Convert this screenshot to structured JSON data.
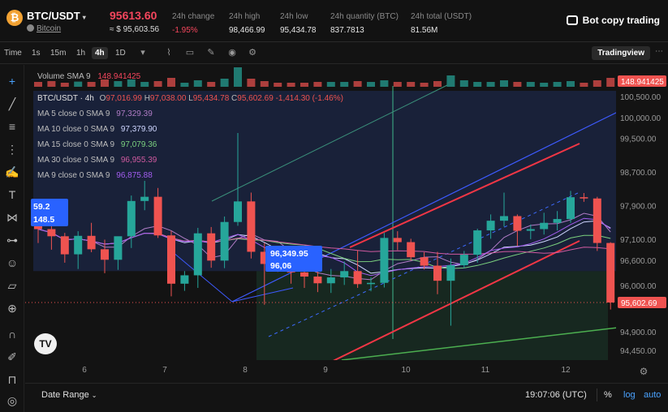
{
  "header": {
    "coin_symbol": "₿",
    "pair": "BTC/USDT",
    "pair_caret": "▾",
    "coin_name": "Bitcoin",
    "price": "95613.60",
    "price_usd": "≈ $ 95,603.56",
    "stats": [
      {
        "label": "24h change",
        "value": "-1.95%",
        "negative": true
      },
      {
        "label": "24h high",
        "value": "98,466.99"
      },
      {
        "label": "24h low",
        "value": "95,434.78"
      },
      {
        "label": "24h quantity (BTC)",
        "value": "837.7813"
      },
      {
        "label": "24h total (USDT)",
        "value": "81.56M"
      }
    ],
    "bot_copy": "Bot copy trading"
  },
  "toolbar": {
    "time_label": "Time",
    "intervals": [
      "1s",
      "15m",
      "1h",
      "4h",
      "1D"
    ],
    "active_interval": "4h",
    "tradingview": "Tradingview"
  },
  "legend": {
    "volume": "Volume SMA 9",
    "volume_value": "148.941425",
    "title": "BTC/USDT · 4h",
    "ohlc": {
      "o": "97,016.99",
      "h": "97,038.00",
      "l": "95,434.78",
      "c": "95,602.69",
      "chg": "-1,414.30 (-1.46%)"
    },
    "ma": [
      {
        "name": "MA 5 close 0 SMA 9",
        "value": "97,329.39",
        "color": "#b07cc6"
      },
      {
        "name": "MA 10 close 0 SMA 9",
        "value": "97,379.90",
        "color": "#cfd6ff"
      },
      {
        "name": "MA 15 close 0 SMA 9",
        "value": "97,079.36",
        "color": "#7bd17f"
      },
      {
        "name": "MA 30 close 0 SMA 9",
        "value": "96,955.39",
        "color": "#d05aa0"
      },
      {
        "name": "MA 9 close 0 SMA 9",
        "value": "96,875.88",
        "color": "#a35df0"
      }
    ]
  },
  "chart_data": {
    "type": "candlestick",
    "timeframe": "4h",
    "ylim": [
      94230,
      100760
    ],
    "y_ticks": [
      "100,500.00",
      "100,000.00",
      "99,500.00",
      "98,700.00",
      "97,900.00",
      "97,100.00",
      "96,600.00",
      "96,000.00",
      "94,900.00",
      "94,450.00"
    ],
    "x_ticks": [
      "6",
      "7",
      "8",
      "9",
      "10",
      "11",
      "12"
    ],
    "price_label": "95,602.69",
    "volume_label": "148.941425",
    "annotation_labels": [
      "96,349.95",
      "96,06",
      "59.2",
      "148.5"
    ],
    "candles": [
      {
        "o": 97640,
        "h": 97850,
        "l": 97020,
        "c": 97350
      },
      {
        "o": 97350,
        "h": 97560,
        "l": 96860,
        "c": 97180
      },
      {
        "o": 97180,
        "h": 97260,
        "l": 96550,
        "c": 96750
      },
      {
        "o": 96750,
        "h": 97300,
        "l": 96400,
        "c": 97190
      },
      {
        "o": 97190,
        "h": 97500,
        "l": 96800,
        "c": 96870
      },
      {
        "o": 96870,
        "h": 97100,
        "l": 96300,
        "c": 96620
      },
      {
        "o": 96620,
        "h": 97120,
        "l": 96380,
        "c": 97180
      },
      {
        "o": 97180,
        "h": 98150,
        "l": 96900,
        "c": 98020
      },
      {
        "o": 98020,
        "h": 98500,
        "l": 97800,
        "c": 98120
      },
      {
        "o": 98120,
        "h": 98330,
        "l": 97140,
        "c": 97200
      },
      {
        "o": 97200,
        "h": 97310,
        "l": 95750,
        "c": 96050
      },
      {
        "o": 96050,
        "h": 96350,
        "l": 95880,
        "c": 96250
      },
      {
        "o": 96250,
        "h": 97380,
        "l": 95950,
        "c": 97250
      },
      {
        "o": 97250,
        "h": 97400,
        "l": 96430,
        "c": 96600
      },
      {
        "o": 96600,
        "h": 97650,
        "l": 96420,
        "c": 97520
      },
      {
        "o": 97520,
        "h": 99640,
        "l": 97430,
        "c": 98010
      },
      {
        "o": 98010,
        "h": 98220,
        "l": 96650,
        "c": 96810
      },
      {
        "o": 96810,
        "h": 97020,
        "l": 95550,
        "c": 96520
      },
      {
        "o": 96520,
        "h": 96700,
        "l": 96330,
        "c": 96430
      },
      {
        "o": 96430,
        "h": 96660,
        "l": 96050,
        "c": 96320
      },
      {
        "o": 96320,
        "h": 96600,
        "l": 95950,
        "c": 96220
      },
      {
        "o": 96220,
        "h": 96400,
        "l": 95850,
        "c": 96060
      },
      {
        "o": 96060,
        "h": 96400,
        "l": 95830,
        "c": 96200
      },
      {
        "o": 96200,
        "h": 96580,
        "l": 96020,
        "c": 96350
      },
      {
        "o": 96350,
        "h": 96850,
        "l": 95950,
        "c": 96040
      },
      {
        "o": 96040,
        "h": 96200,
        "l": 95870,
        "c": 96070
      },
      {
        "o": 96070,
        "h": 97260,
        "l": 95960,
        "c": 97140
      },
      {
        "o": 97140,
        "h": 97300,
        "l": 96850,
        "c": 97040
      },
      {
        "o": 97040,
        "h": 97120,
        "l": 96600,
        "c": 96680
      },
      {
        "o": 96680,
        "h": 96800,
        "l": 96390,
        "c": 96480
      },
      {
        "o": 96480,
        "h": 96810,
        "l": 95800,
        "c": 96120
      },
      {
        "o": 96120,
        "h": 96650,
        "l": 95050,
        "c": 96490
      },
      {
        "o": 96490,
        "h": 96830,
        "l": 96420,
        "c": 96740
      },
      {
        "o": 96740,
        "h": 97360,
        "l": 96550,
        "c": 97320
      },
      {
        "o": 97320,
        "h": 97700,
        "l": 97120,
        "c": 97550
      },
      {
        "o": 97550,
        "h": 98220,
        "l": 97410,
        "c": 97660
      },
      {
        "o": 97660,
        "h": 97700,
        "l": 96950,
        "c": 97310
      },
      {
        "o": 97310,
        "h": 97460,
        "l": 97110,
        "c": 97350
      },
      {
        "o": 97350,
        "h": 97740,
        "l": 97220,
        "c": 97500
      },
      {
        "o": 97500,
        "h": 97780,
        "l": 97320,
        "c": 97590
      },
      {
        "o": 97590,
        "h": 98260,
        "l": 97500,
        "c": 98110
      },
      {
        "o": 98110,
        "h": 98210,
        "l": 98000,
        "c": 98080
      },
      {
        "o": 98080,
        "h": 98120,
        "l": 96830,
        "c": 97020
      },
      {
        "o": 97020,
        "h": 97038,
        "l": 95434.78,
        "c": 95602.69
      }
    ],
    "volumes": [
      3.0,
      3.5,
      2.5,
      3.2,
      3.0,
      4.5,
      3.5,
      4.5,
      3.0,
      3.5,
      5.5,
      2.5,
      4.0,
      3.0,
      5.0,
      12.0,
      5.0,
      3.5,
      2.5,
      2.5,
      2.5,
      3.0,
      3.0,
      3.0,
      3.5,
      3.0,
      4.0,
      3.0,
      3.0,
      2.5,
      3.5,
      7.0,
      4.0,
      3.0,
      3.0,
      4.0,
      3.0,
      3.0,
      2.5,
      3.0,
      3.5,
      2.5,
      4.0,
      5.5
    ]
  },
  "bottom": {
    "date_range": "Date Range",
    "clock": "19:07:06 (UTC)",
    "pct": "%",
    "log": "log",
    "auto": "auto"
  },
  "colors": {
    "up": "#26a69a",
    "down": "#ef5350",
    "channel": "#f23645",
    "blue_line": "#3d5afe",
    "green_line": "#4caf50"
  }
}
